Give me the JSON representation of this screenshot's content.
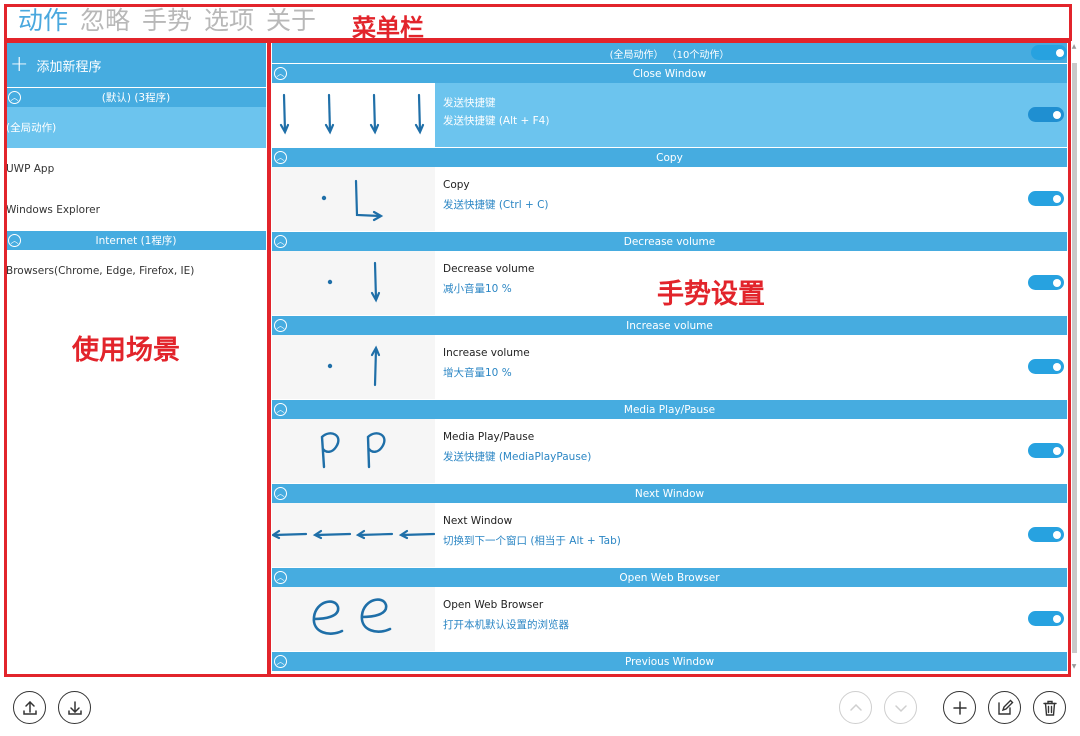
{
  "menu": {
    "items": [
      {
        "label": "动作",
        "active": true
      },
      {
        "label": "忽略",
        "active": false
      },
      {
        "label": "手势",
        "active": false
      },
      {
        "label": "选项",
        "active": false
      },
      {
        "label": "关于",
        "active": false
      }
    ]
  },
  "annotations": {
    "menubar": "菜单栏",
    "scenes": "使用场景",
    "gesture_settings": "手势设置"
  },
  "left": {
    "add_program": "添加新程序",
    "groups": [
      {
        "header": "(默认) (3程序)",
        "items": [
          "(全局动作)",
          "UWP App",
          "Windows Explorer"
        ],
        "selected_index": 0
      },
      {
        "header": "Internet (1程序)",
        "items": [
          "Browsers(Chrome, Edge, Firefox, IE)"
        ],
        "selected_index": -1
      }
    ]
  },
  "right": {
    "global_header": "(全局动作） （10个动作）",
    "global_enabled": true,
    "sections": [
      {
        "header": "Close Window",
        "name": "发送快捷键",
        "desc": "发送快捷键 (Alt + F4)",
        "enabled": true,
        "selected": true,
        "gesture": "down-down-down-down"
      },
      {
        "header": "Copy",
        "name": "Copy",
        "desc": "发送快捷键 (Ctrl + C)",
        "enabled": true,
        "selected": false,
        "gesture": "dot-L"
      },
      {
        "header": "Decrease volume",
        "name": "Decrease volume",
        "desc": "减小音量10 %",
        "enabled": true,
        "selected": false,
        "gesture": "dot-down"
      },
      {
        "header": "Increase volume",
        "name": "Increase volume",
        "desc": "增大音量10 %",
        "enabled": true,
        "selected": false,
        "gesture": "dot-up"
      },
      {
        "header": "Media Play/Pause",
        "name": "Media Play/Pause",
        "desc": "发送快捷键 (MediaPlayPause)",
        "enabled": true,
        "selected": false,
        "gesture": "P-P"
      },
      {
        "header": "Next Window",
        "name": "Next Window",
        "desc": "切换到下一个窗口 (相当于 Alt + Tab)",
        "enabled": true,
        "selected": false,
        "gesture": "left-left-left-left"
      },
      {
        "header": "Open Web Browser",
        "name": "Open Web Browser",
        "desc": "打开本机默认设置的浏览器",
        "enabled": true,
        "selected": false,
        "gesture": "e-e"
      },
      {
        "header": "Previous Window",
        "name": "",
        "desc": "",
        "enabled": true,
        "selected": false,
        "gesture": ""
      }
    ]
  },
  "toolbar": {
    "left_buttons": [
      "upload-icon",
      "download-icon"
    ],
    "right_buttons": [
      "chevron-up-icon",
      "chevron-down-icon",
      "add-icon",
      "edit-icon",
      "delete-icon"
    ]
  },
  "colors": {
    "accent": "#46ace0",
    "selected_row": "#6cc4ee",
    "toggle_on": "#27a2e0",
    "annotation_red": "#e2242b",
    "menu_active": "#4aa8de",
    "menu_inactive": "#b8b8b8"
  }
}
